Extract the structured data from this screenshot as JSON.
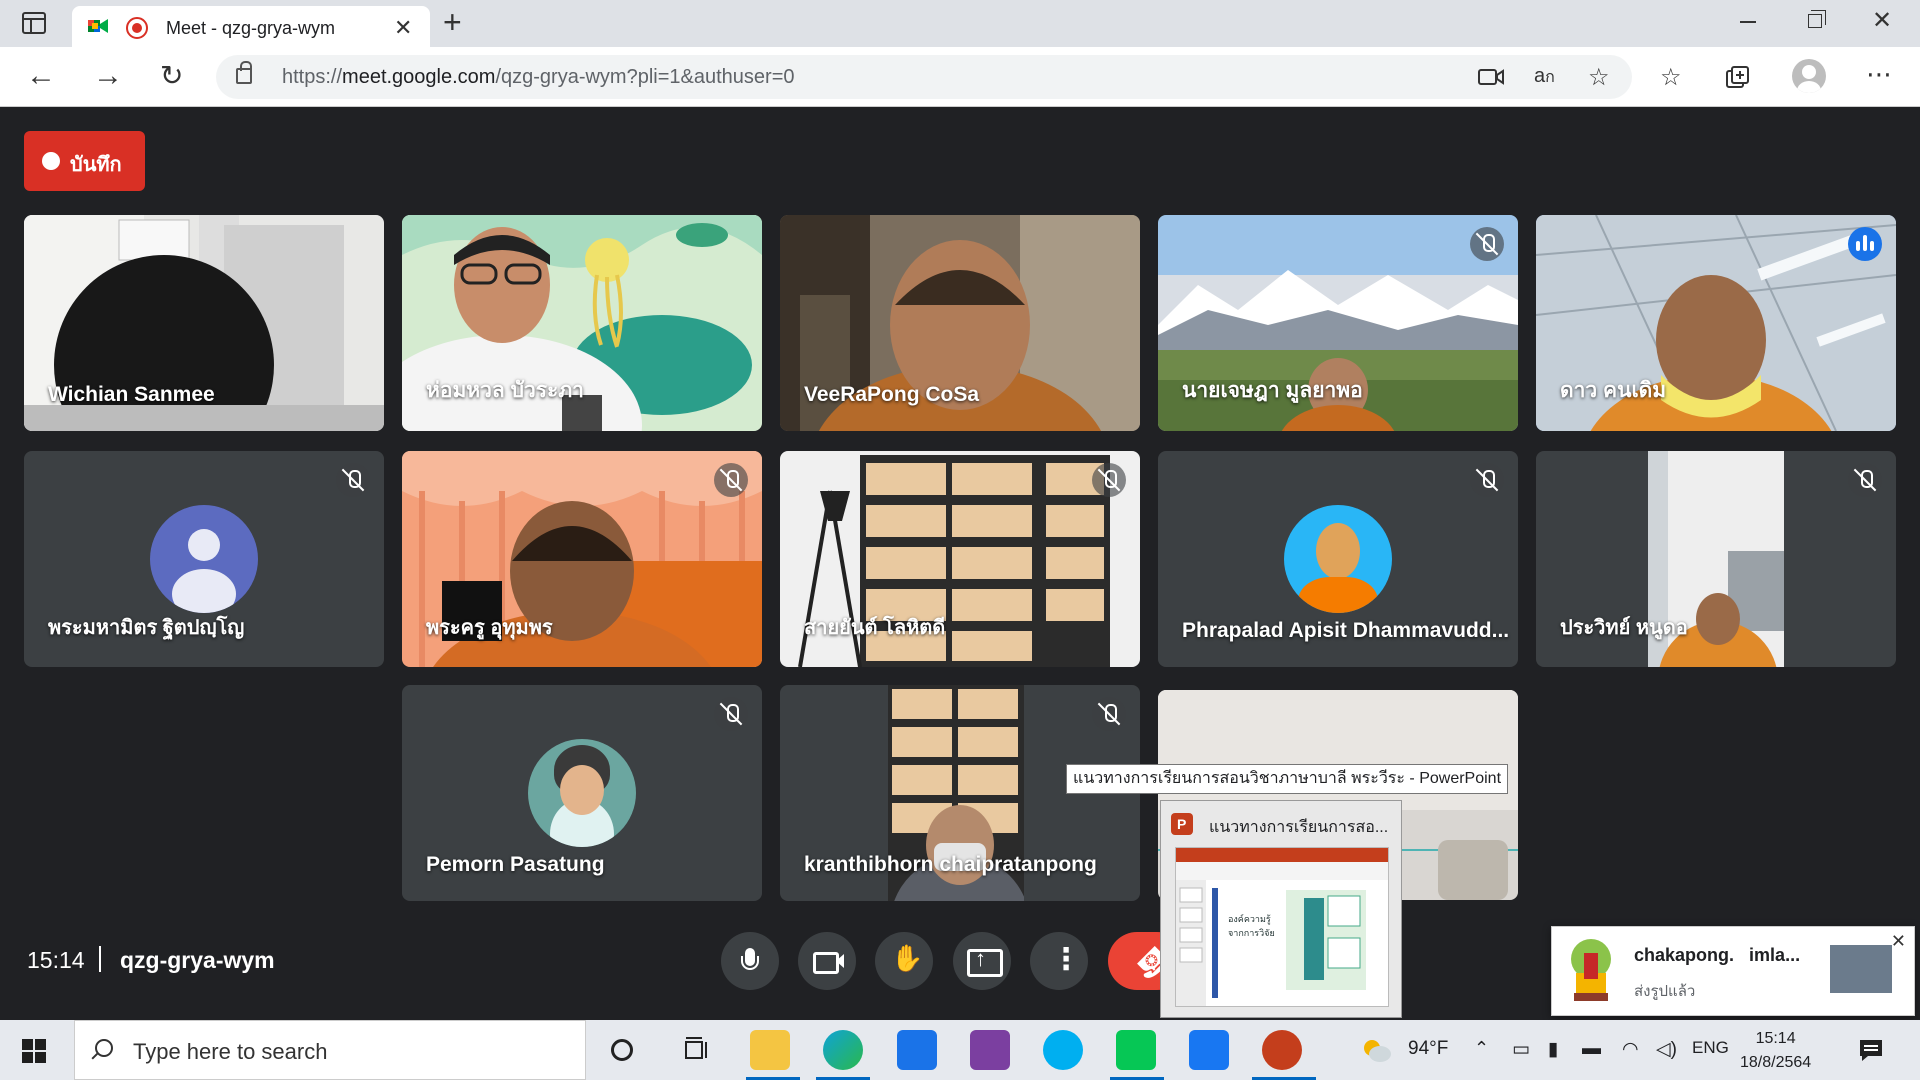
{
  "browser": {
    "tab_title": "Meet - qzg-grya-wym",
    "url_prefix": "https://",
    "url_host": "meet.google.com",
    "url_path": "/qzg-grya-wym?pli=1&authuser=0"
  },
  "meet": {
    "recording_label": "บันทึก",
    "time": "15:14",
    "meeting_code": "qzg-grya-wym",
    "participants": [
      {
        "name": "Wichian Sanmee",
        "muted": false
      },
      {
        "name": "ห่อมหวล บัวระภา",
        "muted": false
      },
      {
        "name": "VeeRaPong CoSa",
        "muted": false
      },
      {
        "name": "นายเจษฎา มูลยาพอ",
        "muted": true
      },
      {
        "name": "ดาว คนเดิม",
        "muted": false,
        "speaking": true
      },
      {
        "name": "พระมหามิตร ฐิตปญฺโญ",
        "muted": true
      },
      {
        "name": "พระครู อุทุมพร",
        "muted": true
      },
      {
        "name": "สายยันต์ โลหิตดี",
        "muted": true
      },
      {
        "name": "Phrapalad Apisit Dhammavudd...",
        "muted": true
      },
      {
        "name": "ประวิทย์ หนูดอ",
        "muted": true
      },
      {
        "name": "Pemorn Pasatung",
        "muted": true
      },
      {
        "name": "kranthibhorn chaipratanpong",
        "muted": true
      }
    ]
  },
  "tooltip": {
    "text": "แนวทางการเรียนการสอนวิชาภาษาบาลี พระวีระ - PowerPoint"
  },
  "thumbnail": {
    "title": "แนวทางการเรียนการสอ...",
    "slide_text": "องค์ความรู้จากการวิจัย"
  },
  "notification": {
    "sender": "chakapong.",
    "sender_extra": "imla...",
    "message": "ส่งรูปแล้ว"
  },
  "taskbar": {
    "search_placeholder": "Type here to search",
    "weather": "94°F",
    "language": "ENG",
    "time": "15:14",
    "date": "18/8/2564"
  }
}
